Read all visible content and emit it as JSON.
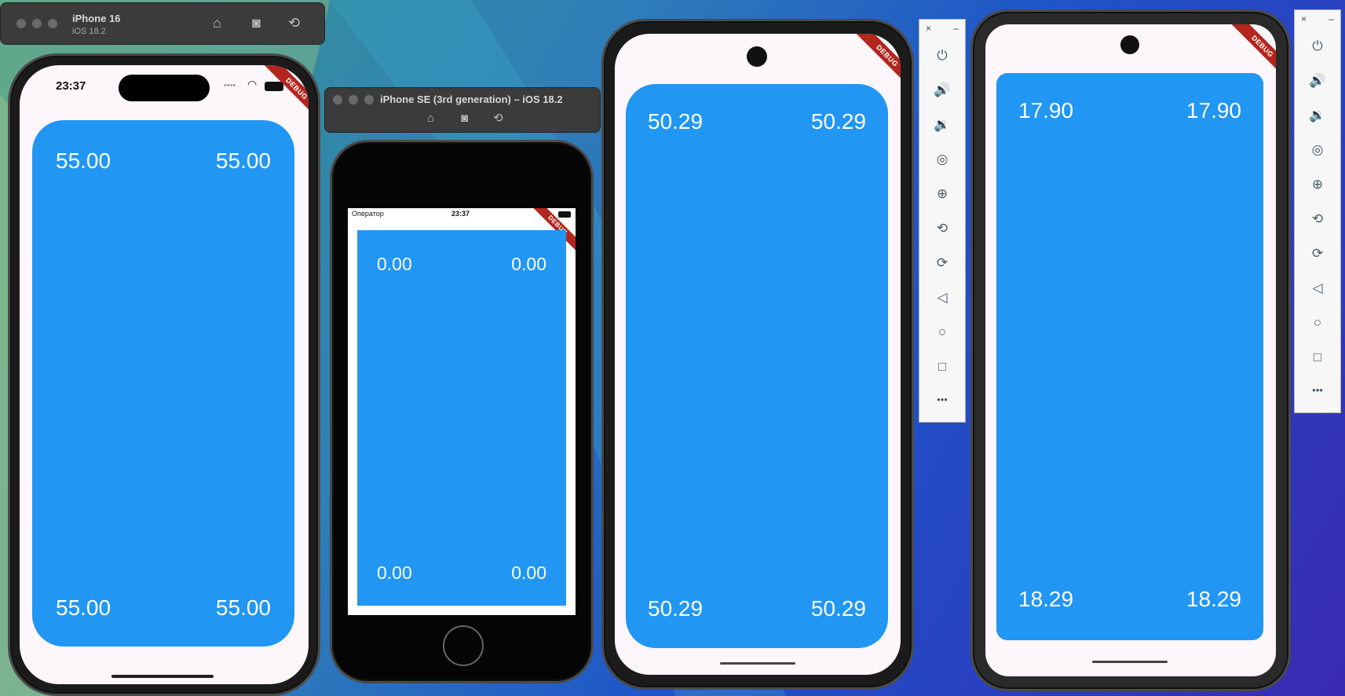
{
  "sim1": {
    "title": "iPhone 16",
    "subtitle": "iOS 18.2",
    "icons": [
      "home-icon",
      "screenshot-icon",
      "rotate-icon"
    ]
  },
  "sim2": {
    "title": "iPhone SE (3rd generation) – iOS 18.2",
    "icons": [
      "home-icon",
      "screenshot-icon",
      "rotate-icon"
    ]
  },
  "phone1": {
    "time": "23:37",
    "debug": "DEBUG",
    "values": [
      "55.00",
      "55.00",
      "55.00",
      "55.00"
    ]
  },
  "phone2": {
    "carrier": "Оператор",
    "time": "23:37",
    "debug": "DEBUG",
    "values": [
      "0.00",
      "0.00",
      "0.00",
      "0.00"
    ]
  },
  "phone3": {
    "debug": "DEBUG",
    "values": [
      "50.29",
      "50.29",
      "50.29",
      "50.29"
    ]
  },
  "phone4": {
    "debug": "DEBUG",
    "values": [
      "17.90",
      "17.90",
      "18.29",
      "18.29"
    ]
  },
  "android_panel": {
    "close": "×",
    "minimize": "–",
    "buttons": [
      "power",
      "volume-up",
      "volume-down",
      "camera",
      "zoom",
      "rotate-left",
      "rotate-right",
      "back",
      "home",
      "overview",
      "more"
    ],
    "more": "•••"
  },
  "colors": {
    "card": "#2196f3",
    "debug": "#b3261e"
  }
}
